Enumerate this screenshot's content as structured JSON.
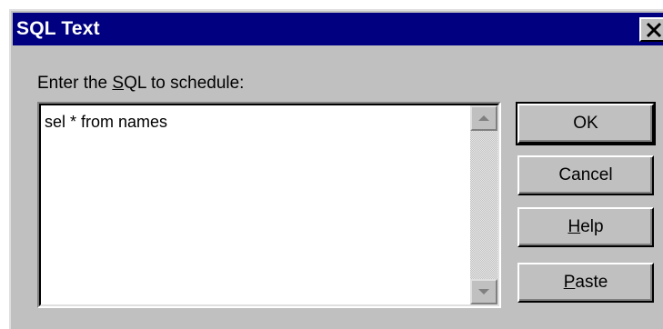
{
  "window": {
    "title": "SQL Text",
    "close_label": "×"
  },
  "prompt": {
    "before": "Enter the ",
    "accel": "S",
    "after": "QL to schedule:"
  },
  "sql_input": {
    "value": "sel * from names"
  },
  "buttons": {
    "ok": {
      "label": "OK"
    },
    "cancel": {
      "label": "Cancel"
    },
    "help": {
      "accel": "H",
      "rest": "elp"
    },
    "paste": {
      "accel": "P",
      "rest": "aste"
    }
  },
  "colors": {
    "titlebar": "#000080",
    "face": "#c0c0c0"
  },
  "icons": {
    "close": "close-x-icon",
    "scroll_up": "triangle-up-icon",
    "scroll_down": "triangle-down-icon"
  }
}
